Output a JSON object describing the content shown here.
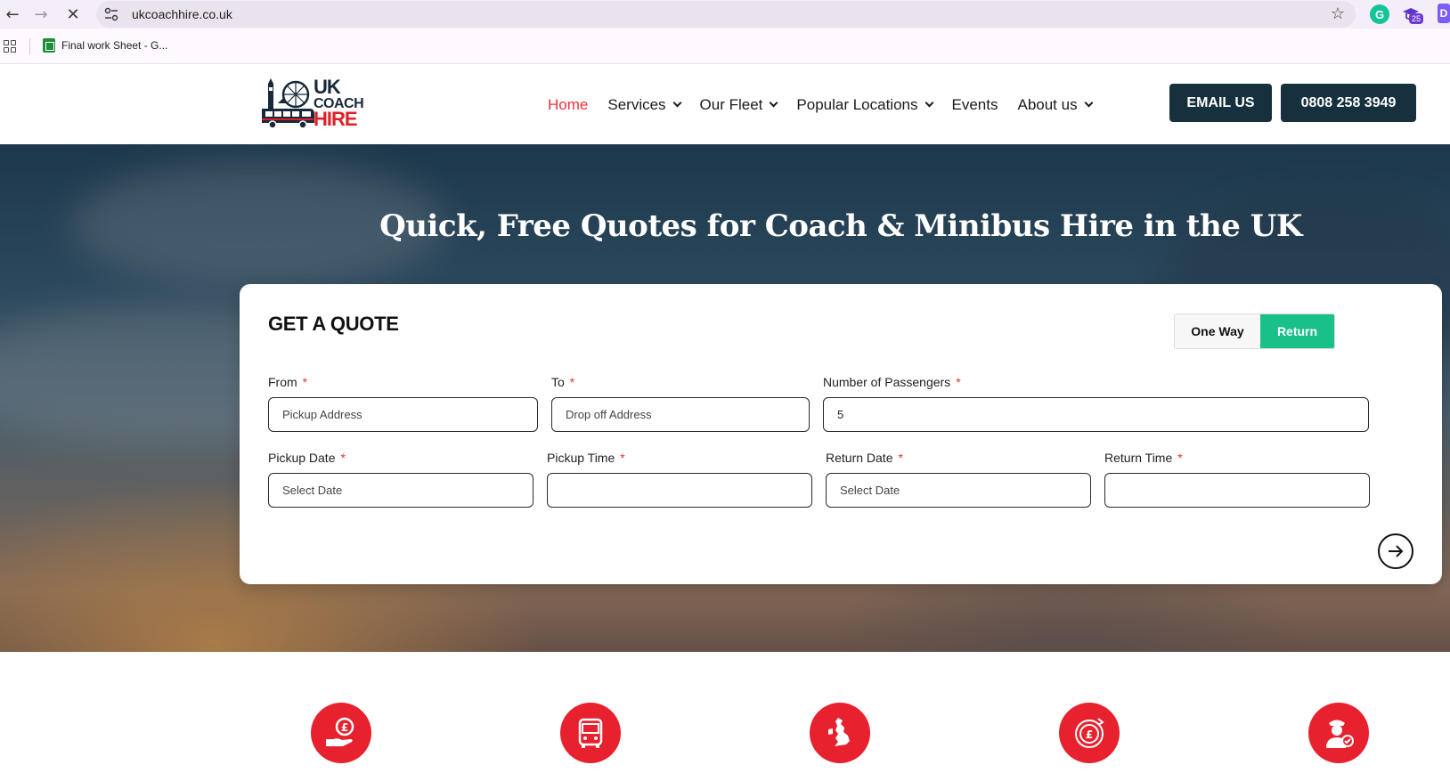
{
  "browser": {
    "url": "ukcoachhire.co.uk",
    "bookmark_label": "Final work Sheet - G...",
    "extension_badge": "25",
    "icons": [
      "back-arrow",
      "forward-arrow",
      "stop-loading",
      "site-settings",
      "bookmark-star",
      "grammarly",
      "graduation-cap",
      "d-extension",
      "apps-grid",
      "sheets"
    ]
  },
  "header": {
    "logo": {
      "line1": "UK",
      "line2": "COACH",
      "line3": "HIRE"
    },
    "nav": [
      {
        "label": "Home",
        "active": true,
        "dropdown": false
      },
      {
        "label": "Services",
        "active": false,
        "dropdown": true
      },
      {
        "label": "Our Fleet",
        "active": false,
        "dropdown": true
      },
      {
        "label": "Popular Locations",
        "active": false,
        "dropdown": true
      },
      {
        "label": "Events",
        "active": false,
        "dropdown": false
      },
      {
        "label": "About us",
        "active": false,
        "dropdown": true
      }
    ],
    "email_button": "EMAIL US",
    "phone_button": "0808 258 3949"
  },
  "hero": {
    "title": "Quick, Free Quotes for Coach & Minibus Hire in the UK"
  },
  "quote": {
    "title": "GET A QUOTE",
    "trip_types": [
      "One Way",
      "Return"
    ],
    "selected_trip": "Return",
    "required_marker": "*",
    "fields": {
      "from": {
        "label": "From",
        "placeholder": "Pickup Address",
        "value": ""
      },
      "to": {
        "label": "To",
        "placeholder": "Drop off Address",
        "value": ""
      },
      "passengers": {
        "label": "Number of Passengers",
        "placeholder": "",
        "value": "5"
      },
      "pickup_date": {
        "label": "Pickup Date",
        "placeholder": "Select Date",
        "value": ""
      },
      "pickup_time": {
        "label": "Pickup Time",
        "placeholder": "",
        "value": ""
      },
      "return_date": {
        "label": "Return Date",
        "placeholder": "Select Date",
        "value": ""
      },
      "return_time": {
        "label": "Return Time",
        "placeholder": "",
        "value": ""
      }
    }
  },
  "features": {
    "icons": [
      "pound-hand-icon",
      "bus-front-icon",
      "uk-map-icon",
      "pound-target-icon",
      "driver-check-icon"
    ]
  },
  "colors": {
    "brand_red": "#e8212e",
    "dark_navy": "#16303d",
    "toggle_green": "#19c08a",
    "nav_active": "#e8323a"
  }
}
